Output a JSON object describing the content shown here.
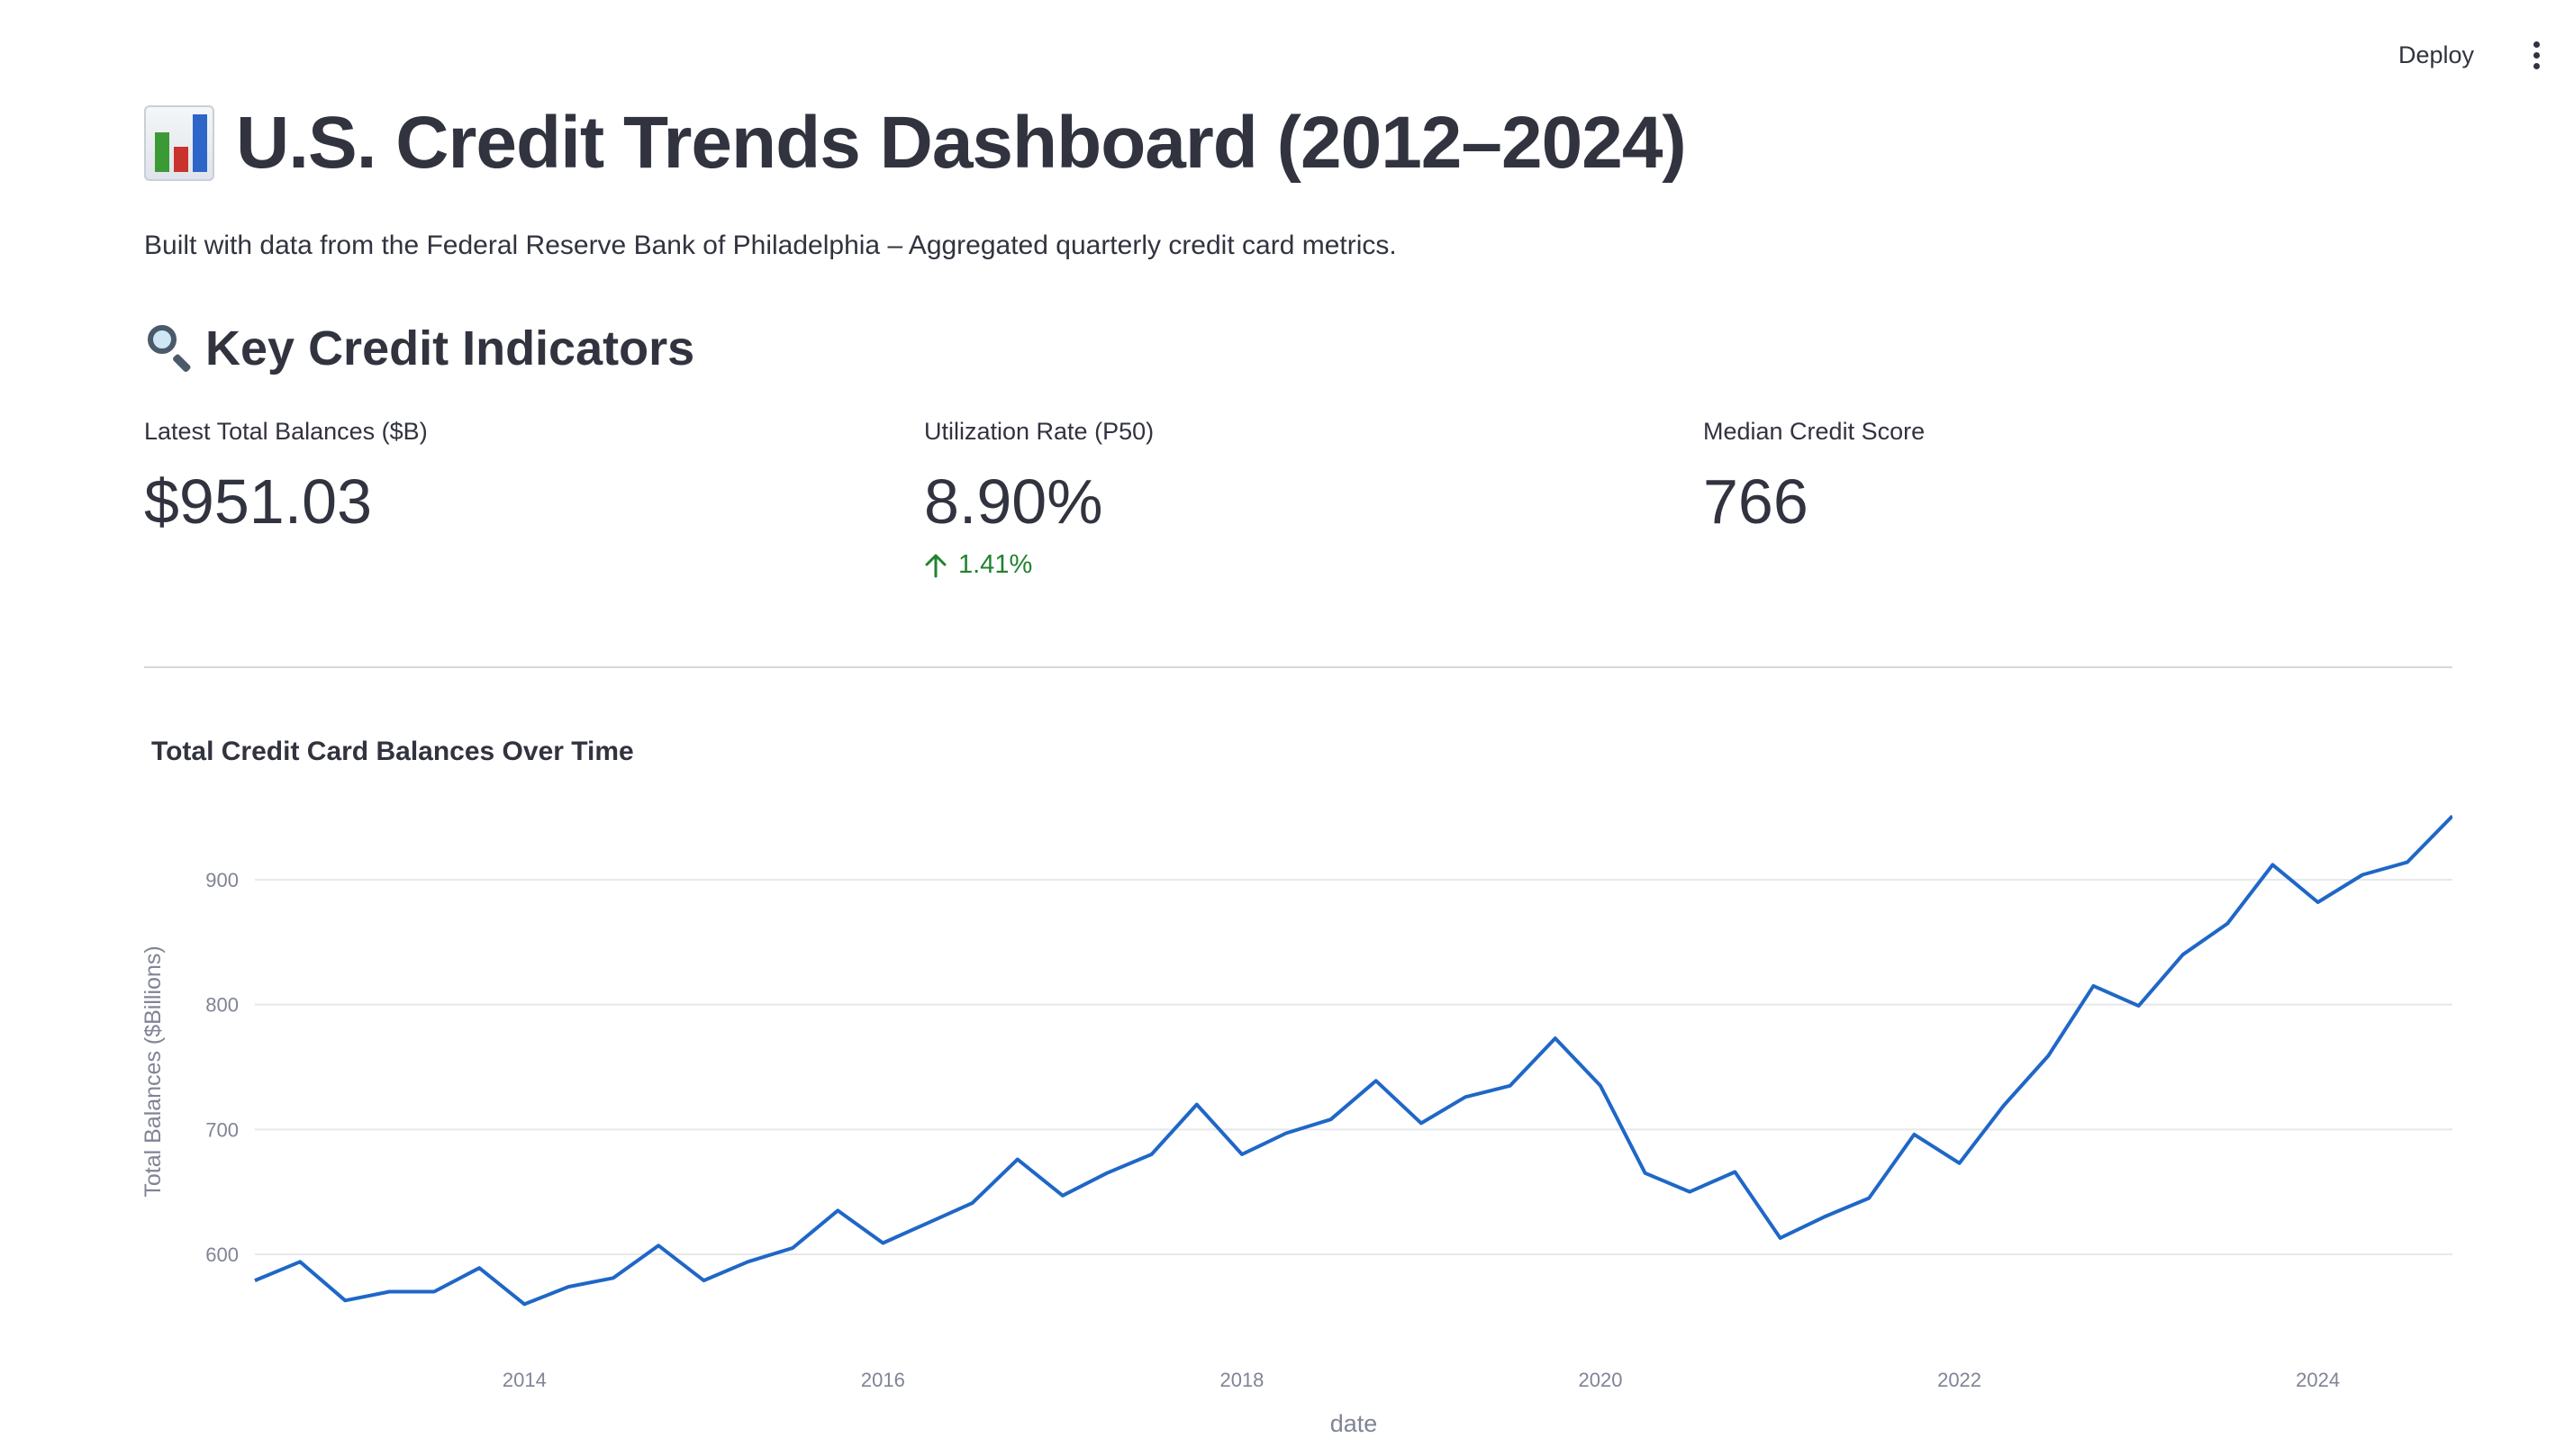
{
  "app": {
    "deploy_label": "Deploy",
    "menu_icon": "kebab-menu-icon"
  },
  "header": {
    "title_icon": "bar-chart-icon",
    "title": "U.S. Credit Trends Dashboard (2012–2024)",
    "subtitle": "Built with data from the Federal Reserve Bank of Philadelphia – Aggregated quarterly credit card metrics."
  },
  "section": {
    "icon": "magnifier-icon",
    "title": "Key Credit Indicators"
  },
  "metrics": [
    {
      "label": "Latest Total Balances ($B)",
      "value": "$951.03",
      "delta": ""
    },
    {
      "label": "Utilization Rate (P50)",
      "value": "8.90%",
      "delta": "1.41%",
      "delta_direction": "up",
      "delta_color": "#21822f"
    },
    {
      "label": "Median Credit Score",
      "value": "766",
      "delta": ""
    }
  ],
  "chart_data": {
    "type": "line",
    "title": "Total Credit Card Balances Over Time",
    "xlabel": "date",
    "ylabel": "Total Balances ($Billions)",
    "x_ticks": [
      "2014",
      "2016",
      "2018",
      "2020",
      "2022",
      "2024"
    ],
    "y_ticks": [
      600,
      700,
      800,
      900
    ],
    "ylim": [
      530,
      970
    ],
    "xlim": [
      "2012-07-01",
      "2024-10-01"
    ],
    "grid": true,
    "line_color": "#1f67c7",
    "series": [
      {
        "x": [
          "2012-07-01",
          "2012-10-01",
          "2013-01-01",
          "2013-04-01",
          "2013-07-01",
          "2013-10-01",
          "2014-01-01",
          "2014-04-01",
          "2014-07-01",
          "2014-10-01",
          "2015-01-01",
          "2015-04-01",
          "2015-07-01",
          "2015-10-01",
          "2016-01-01",
          "2016-04-01",
          "2016-07-01",
          "2016-10-01",
          "2017-01-01",
          "2017-04-01",
          "2017-07-01",
          "2017-10-01",
          "2018-01-01",
          "2018-04-01",
          "2018-07-01",
          "2018-10-01",
          "2019-01-01",
          "2019-04-01",
          "2019-07-01",
          "2019-10-01",
          "2020-01-01",
          "2020-04-01",
          "2020-07-01",
          "2020-10-01",
          "2021-01-01",
          "2021-04-01",
          "2021-07-01",
          "2021-10-01",
          "2022-01-01",
          "2022-04-01",
          "2022-07-01",
          "2022-10-01",
          "2023-01-01",
          "2023-04-01",
          "2023-07-01",
          "2023-10-01",
          "2024-01-01",
          "2024-04-01",
          "2024-07-01",
          "2024-10-01"
        ],
        "values": [
          579,
          594,
          563,
          570,
          570,
          589,
          560,
          574,
          581,
          607,
          579,
          594,
          605,
          635,
          609,
          625,
          641,
          676,
          647,
          665,
          680,
          720,
          680,
          697,
          708,
          739,
          705,
          726,
          735,
          773,
          735,
          665,
          650,
          666,
          613,
          630,
          645,
          696,
          673,
          719,
          759,
          815,
          799,
          840,
          865,
          912,
          882,
          904,
          914,
          951
        ]
      }
    ]
  }
}
